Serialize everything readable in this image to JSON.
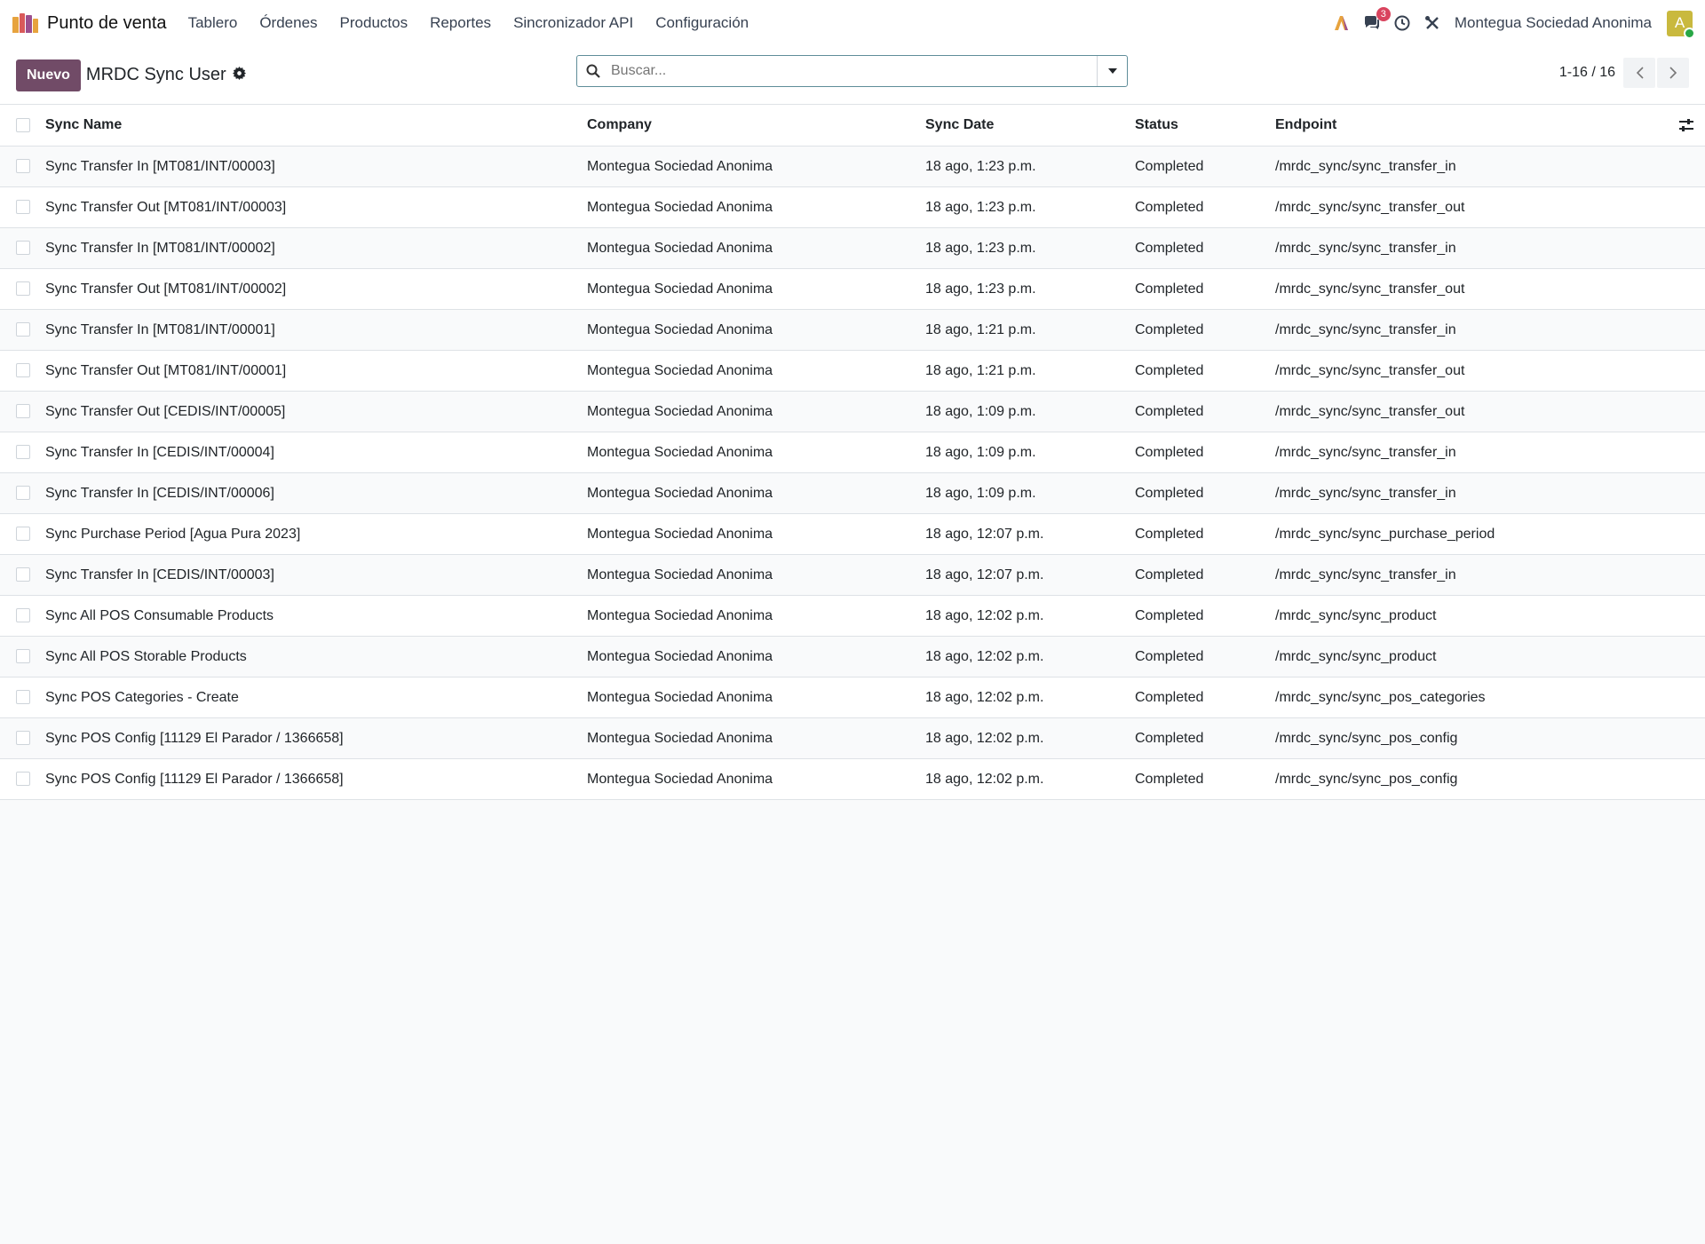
{
  "navbar": {
    "app_name": "Punto de venta",
    "menu": [
      "Tablero",
      "Órdenes",
      "Productos",
      "Reportes",
      "Sincronizador API",
      "Configuración"
    ],
    "chat_badge": "3",
    "company": "Montegua Sociedad Anonima",
    "avatar_letter": "A",
    "icons": [
      "ai-icon",
      "chat-icon",
      "clock-icon",
      "tools-icon"
    ]
  },
  "control_panel": {
    "new_button": "Nuevo",
    "breadcrumb": "MRDC Sync User",
    "search_placeholder": "Buscar...",
    "pager": "1-16 / 16"
  },
  "table": {
    "columns": [
      "Sync Name",
      "Company",
      "Sync Date",
      "Status",
      "Endpoint"
    ],
    "rows": [
      [
        "Sync Transfer In [MT081/INT/00003]",
        "Montegua Sociedad Anonima",
        "18 ago, 1:23 p.m.",
        "Completed",
        "/mrdc_sync/sync_transfer_in"
      ],
      [
        "Sync Transfer Out [MT081/INT/00003]",
        "Montegua Sociedad Anonima",
        "18 ago, 1:23 p.m.",
        "Completed",
        "/mrdc_sync/sync_transfer_out"
      ],
      [
        "Sync Transfer In [MT081/INT/00002]",
        "Montegua Sociedad Anonima",
        "18 ago, 1:23 p.m.",
        "Completed",
        "/mrdc_sync/sync_transfer_in"
      ],
      [
        "Sync Transfer Out [MT081/INT/00002]",
        "Montegua Sociedad Anonima",
        "18 ago, 1:23 p.m.",
        "Completed",
        "/mrdc_sync/sync_transfer_out"
      ],
      [
        "Sync Transfer In [MT081/INT/00001]",
        "Montegua Sociedad Anonima",
        "18 ago, 1:21 p.m.",
        "Completed",
        "/mrdc_sync/sync_transfer_in"
      ],
      [
        "Sync Transfer Out [MT081/INT/00001]",
        "Montegua Sociedad Anonima",
        "18 ago, 1:21 p.m.",
        "Completed",
        "/mrdc_sync/sync_transfer_out"
      ],
      [
        "Sync Transfer Out [CEDIS/INT/00005]",
        "Montegua Sociedad Anonima",
        "18 ago, 1:09 p.m.",
        "Completed",
        "/mrdc_sync/sync_transfer_out"
      ],
      [
        "Sync Transfer In [CEDIS/INT/00004]",
        "Montegua Sociedad Anonima",
        "18 ago, 1:09 p.m.",
        "Completed",
        "/mrdc_sync/sync_transfer_in"
      ],
      [
        "Sync Transfer In [CEDIS/INT/00006]",
        "Montegua Sociedad Anonima",
        "18 ago, 1:09 p.m.",
        "Completed",
        "/mrdc_sync/sync_transfer_in"
      ],
      [
        "Sync Purchase Period [Agua Pura 2023]",
        "Montegua Sociedad Anonima",
        "18 ago, 12:07 p.m.",
        "Completed",
        "/mrdc_sync/sync_purchase_period"
      ],
      [
        "Sync Transfer In [CEDIS/INT/00003]",
        "Montegua Sociedad Anonima",
        "18 ago, 12:07 p.m.",
        "Completed",
        "/mrdc_sync/sync_transfer_in"
      ],
      [
        "Sync All POS Consumable Products",
        "Montegua Sociedad Anonima",
        "18 ago, 12:02 p.m.",
        "Completed",
        "/mrdc_sync/sync_product"
      ],
      [
        "Sync All POS Storable Products",
        "Montegua Sociedad Anonima",
        "18 ago, 12:02 p.m.",
        "Completed",
        "/mrdc_sync/sync_product"
      ],
      [
        "Sync POS Categories - Create",
        "Montegua Sociedad Anonima",
        "18 ago, 12:02 p.m.",
        "Completed",
        "/mrdc_sync/sync_pos_categories"
      ],
      [
        "Sync POS Config [11129 El Parador / 1366658]",
        "Montegua Sociedad Anonima",
        "18 ago, 12:02 p.m.",
        "Completed",
        "/mrdc_sync/sync_pos_config"
      ],
      [
        "Sync POS Config [11129 El Parador / 1366658]",
        "Montegua Sociedad Anonima",
        "18 ago, 12:02 p.m.",
        "Completed",
        "/mrdc_sync/sync_pos_config"
      ]
    ]
  },
  "colors": {
    "brand": "#714b67",
    "badge": "#d9445e",
    "avatar": "#c9b93e"
  }
}
